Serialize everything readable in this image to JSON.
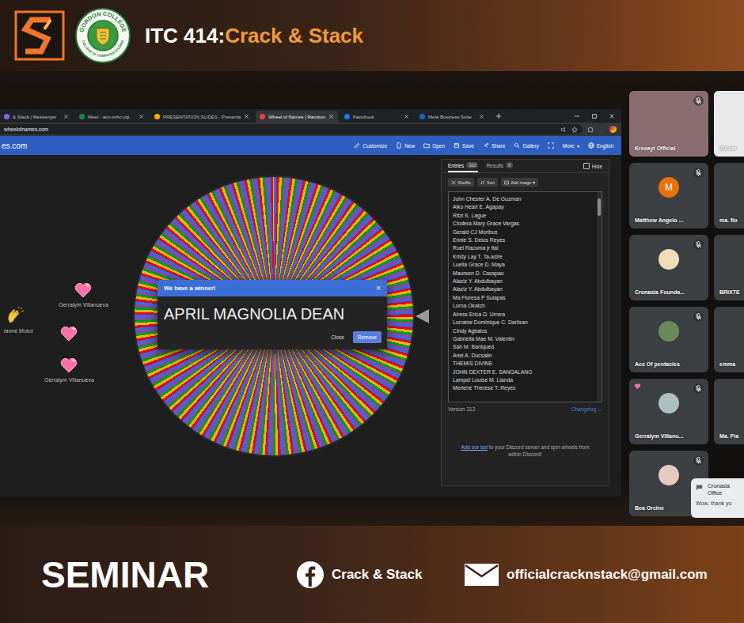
{
  "header": {
    "seal_text": "GORDON COLLEGE",
    "seal_subtext": "COLLEGE OF COMPUTER STUDIES",
    "course": "ITC 414:",
    "title": "Crack & Stack"
  },
  "browser": {
    "tabs": [
      {
        "label": "& Stack | Messenger",
        "selected": false,
        "color": "#8b5cf6"
      },
      {
        "label": "Meet - acn-svhc-yqi",
        "selected": false,
        "color": "#1e8e3e"
      },
      {
        "label": "PRESENTATION SLIDES - Presenta",
        "selected": false,
        "color": "#f4b400"
      },
      {
        "label": "Wheel of Names | Random",
        "selected": true,
        "color": "#e8453c"
      },
      {
        "label": "Facebook",
        "selected": false,
        "color": "#1877f2"
      },
      {
        "label": "Meta Business Suite",
        "selected": false,
        "color": "#0668e1"
      }
    ],
    "url": "wheelofnames.com"
  },
  "app": {
    "brand": "es.com",
    "toolbar": [
      {
        "label": "Customize"
      },
      {
        "label": "New"
      },
      {
        "label": "Open"
      },
      {
        "label": "Save"
      },
      {
        "label": "Share"
      },
      {
        "label": "Gallery"
      },
      {
        "label": "More",
        "caret": "▾"
      },
      {
        "label": "English"
      }
    ],
    "reactions": [
      {
        "kind": "clap",
        "name": "ianne Motol"
      },
      {
        "kind": "heart",
        "name": "Gerralym Villanueva"
      },
      {
        "kind": "heart"
      },
      {
        "kind": "heart",
        "name": "Gerralym Villanueva"
      }
    ],
    "winner_dialog": {
      "title": "We have a winner!",
      "close_glyph": "×",
      "winner": "APRIL MAGNOLIA DEAN",
      "buttons": [
        "Close",
        "Remove"
      ]
    },
    "entries_panel": {
      "tabs": [
        {
          "label": "Entries",
          "count": "322",
          "selected": true
        },
        {
          "label": "Results",
          "count": "5",
          "selected": false
        }
      ],
      "hide": {
        "label": "Hide",
        "checked": false
      },
      "actions": [
        {
          "label": "Shuffle"
        },
        {
          "label": "Sort"
        },
        {
          "label": "Add image",
          "caret": "▾"
        }
      ],
      "names": [
        "John Chester A. De Guzman",
        "Aiko Heart E. Agapay",
        "Ritzi S. Lague",
        "Clodera Mary Grace Vargas",
        "Gerald CJ Moribus",
        "Ennie S. Delos Reyes",
        "Ruel Racoma jr fial",
        "Kristy Lay T. Ta-asire",
        "Luella Grace D. Maya",
        "Maureen D. Casapao",
        "Alaziz Y. Abdulbayan",
        "Alaziz Y. Abdulbayan",
        "Ma Floresa P Sulapas",
        "Lorna Okatch",
        "Airess Erica D. Urrera",
        "Lorraine Dominique C. Dariisan",
        "Cindy Agbalos",
        "Gabriella Mae M. Valentin",
        "Sah M. Banlqued",
        "Ariel A. Ducsalin",
        "THEMIS DIVINE",
        "JOHN DEXTER E. SANGALANG",
        "Lampel Louise M. Llanda",
        "Merlene Therese T. Reyes"
      ],
      "version": "Version 313",
      "changelog": "Changelog",
      "changelog_caret": "⌄",
      "discord_link": "Add our bot",
      "discord_text": " to your Discord server and spin wheels from within Discord!"
    }
  },
  "participants": [
    {
      "name": "Kreeayt Official",
      "kind": "video",
      "color": "#8a6d70",
      "muted": true,
      "active": false,
      "reacting": false
    },
    {
      "name": "Jordar",
      "kind": "video",
      "color": "#e9e9e9",
      "muted": false,
      "active": true,
      "reacting": false
    },
    {
      "name": "Matthew Angelo ...",
      "kind": "letter",
      "letter": "M",
      "color": "#e8710a",
      "muted": true,
      "active": false,
      "reacting": false
    },
    {
      "name": "ma. flo",
      "kind": "blank",
      "muted": false,
      "active": false,
      "reacting": false
    },
    {
      "name": "Cronasia Founda...",
      "kind": "image",
      "color": "#f1dcb8",
      "muted": true,
      "active": false,
      "reacting": false
    },
    {
      "name": "BRIXTE",
      "kind": "blank",
      "muted": false,
      "active": false,
      "reacting": false
    },
    {
      "name": "Ace Of pentacles",
      "kind": "image",
      "color": "#6b8a5a",
      "muted": true,
      "active": false,
      "reacting": false
    },
    {
      "name": "emma",
      "kind": "blank",
      "muted": false,
      "active": false,
      "reacting": false
    },
    {
      "name": "Gerralym Villanu...",
      "kind": "image",
      "color": "#aebfc2",
      "muted": true,
      "active": false,
      "reacting": true
    },
    {
      "name": "Ma. Pia",
      "kind": "blank",
      "muted": false,
      "active": false,
      "reacting": false
    },
    {
      "name": "Bea Orcine",
      "kind": "image",
      "color": "#e6c9bf",
      "muted": true,
      "active": false,
      "reacting": false
    }
  ],
  "chat_popup": {
    "sender": "Cronasia",
    "sender_line2": "Office",
    "message": "Wow, thank yo"
  },
  "footer": {
    "label": "SEMINAR",
    "facebook": "Crack & Stack",
    "email": "officialcracknstack@gmail.com"
  }
}
